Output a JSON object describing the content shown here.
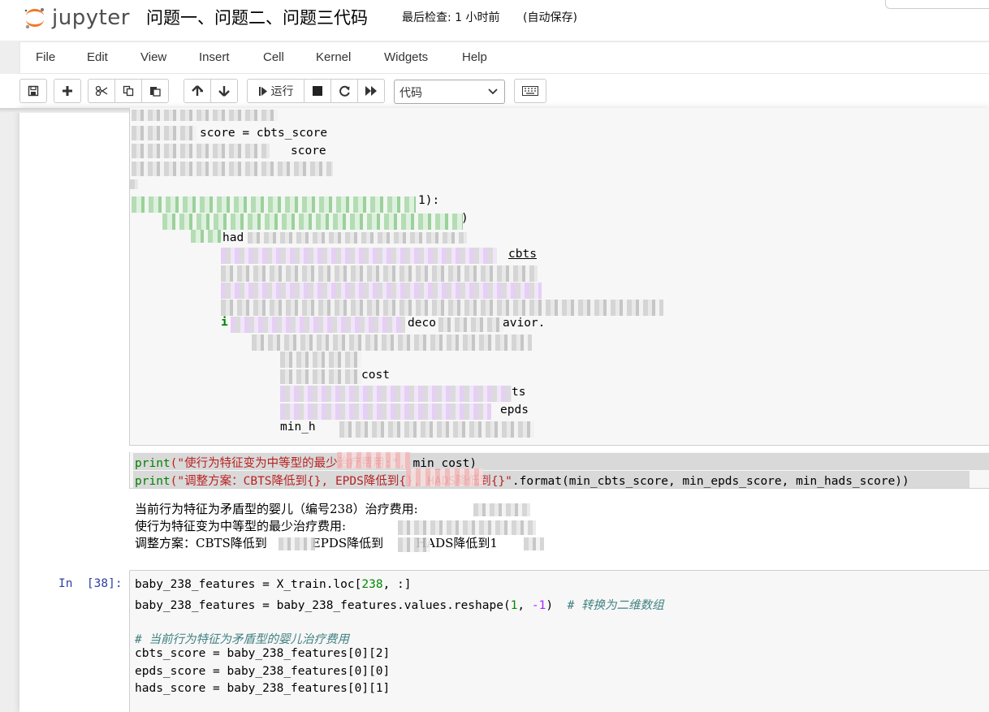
{
  "header": {
    "logo_text": "jupyter",
    "notebook_title": "问题一、问题二、问题三代码",
    "checkpoint": "最后检查: 1 小时前",
    "autosave": "(自动保存)"
  },
  "menu": [
    "File",
    "Edit",
    "View",
    "Insert",
    "Cell",
    "Kernel",
    "Widgets",
    "Help"
  ],
  "toolbar": {
    "run_label": "运行",
    "cell_type": "代码",
    "icons": [
      "save-icon",
      "plus-icon",
      "cut-icon",
      "copy-icon",
      "paste-icon",
      "arrow-up-icon",
      "arrow-down-icon",
      "step-forward-icon",
      "stop-icon",
      "restart-icon",
      "fast-forward-icon",
      "keyboard-icon"
    ]
  },
  "cell1": {
    "visible_fragments": {
      "l1": "score = cbts_score",
      "l2": "score",
      "l3": "1):",
      "l4": ")",
      "l5": "had",
      "l6": "cbts",
      "l7": "i",
      "l8": "deco",
      "l9": "avior.",
      "l10": "cost",
      "l11": "ts",
      "l12": "epds",
      "l13": "min_h"
    },
    "print1_func": "print",
    "print1_str": "(\"使行为特征变为中等型的最少治疗费用:\",",
    "print1_rest": " min_cost)",
    "print2_func": "print",
    "print2_str": "(\"调整方案：CBTS降低到{}, EPDS降低到{}, HADS降低到{}\"",
    "print2_rest": ".format(min_cbts_score, min_epds_score, min_hads_score))"
  },
  "output1": {
    "line1": "当前行为特征为矛盾型的婴儿（编号238）治疗费用:",
    "line2": "使行为特征变为中等型的最少治疗费用:",
    "line3a": "调整方案：CBTS降低到",
    "line3b": "EPDS降低到",
    "line3c": "HADS降低到1"
  },
  "cell38": {
    "prompt": "In  [38]:",
    "line1_a": "baby_238_features = X_train.loc[",
    "line1_num": "238",
    "line1_b": ", :]",
    "line2_a": "baby_238_features = baby_238_features.values.reshape(",
    "line2_n1": "1",
    "line2_c": ", ",
    "line2_n2": "-1",
    "line2_d": ")  ",
    "line2_com": "# 转换为二维数组",
    "line3_com": "# 当前行为特征为矛盾型的婴儿治疗费用",
    "line4": "cbts_score = baby_238_features[0][2]",
    "line5": "epds_score = baby_238_features[0][0]",
    "line6": "hads_score = baby_238_features[0][1]"
  }
}
